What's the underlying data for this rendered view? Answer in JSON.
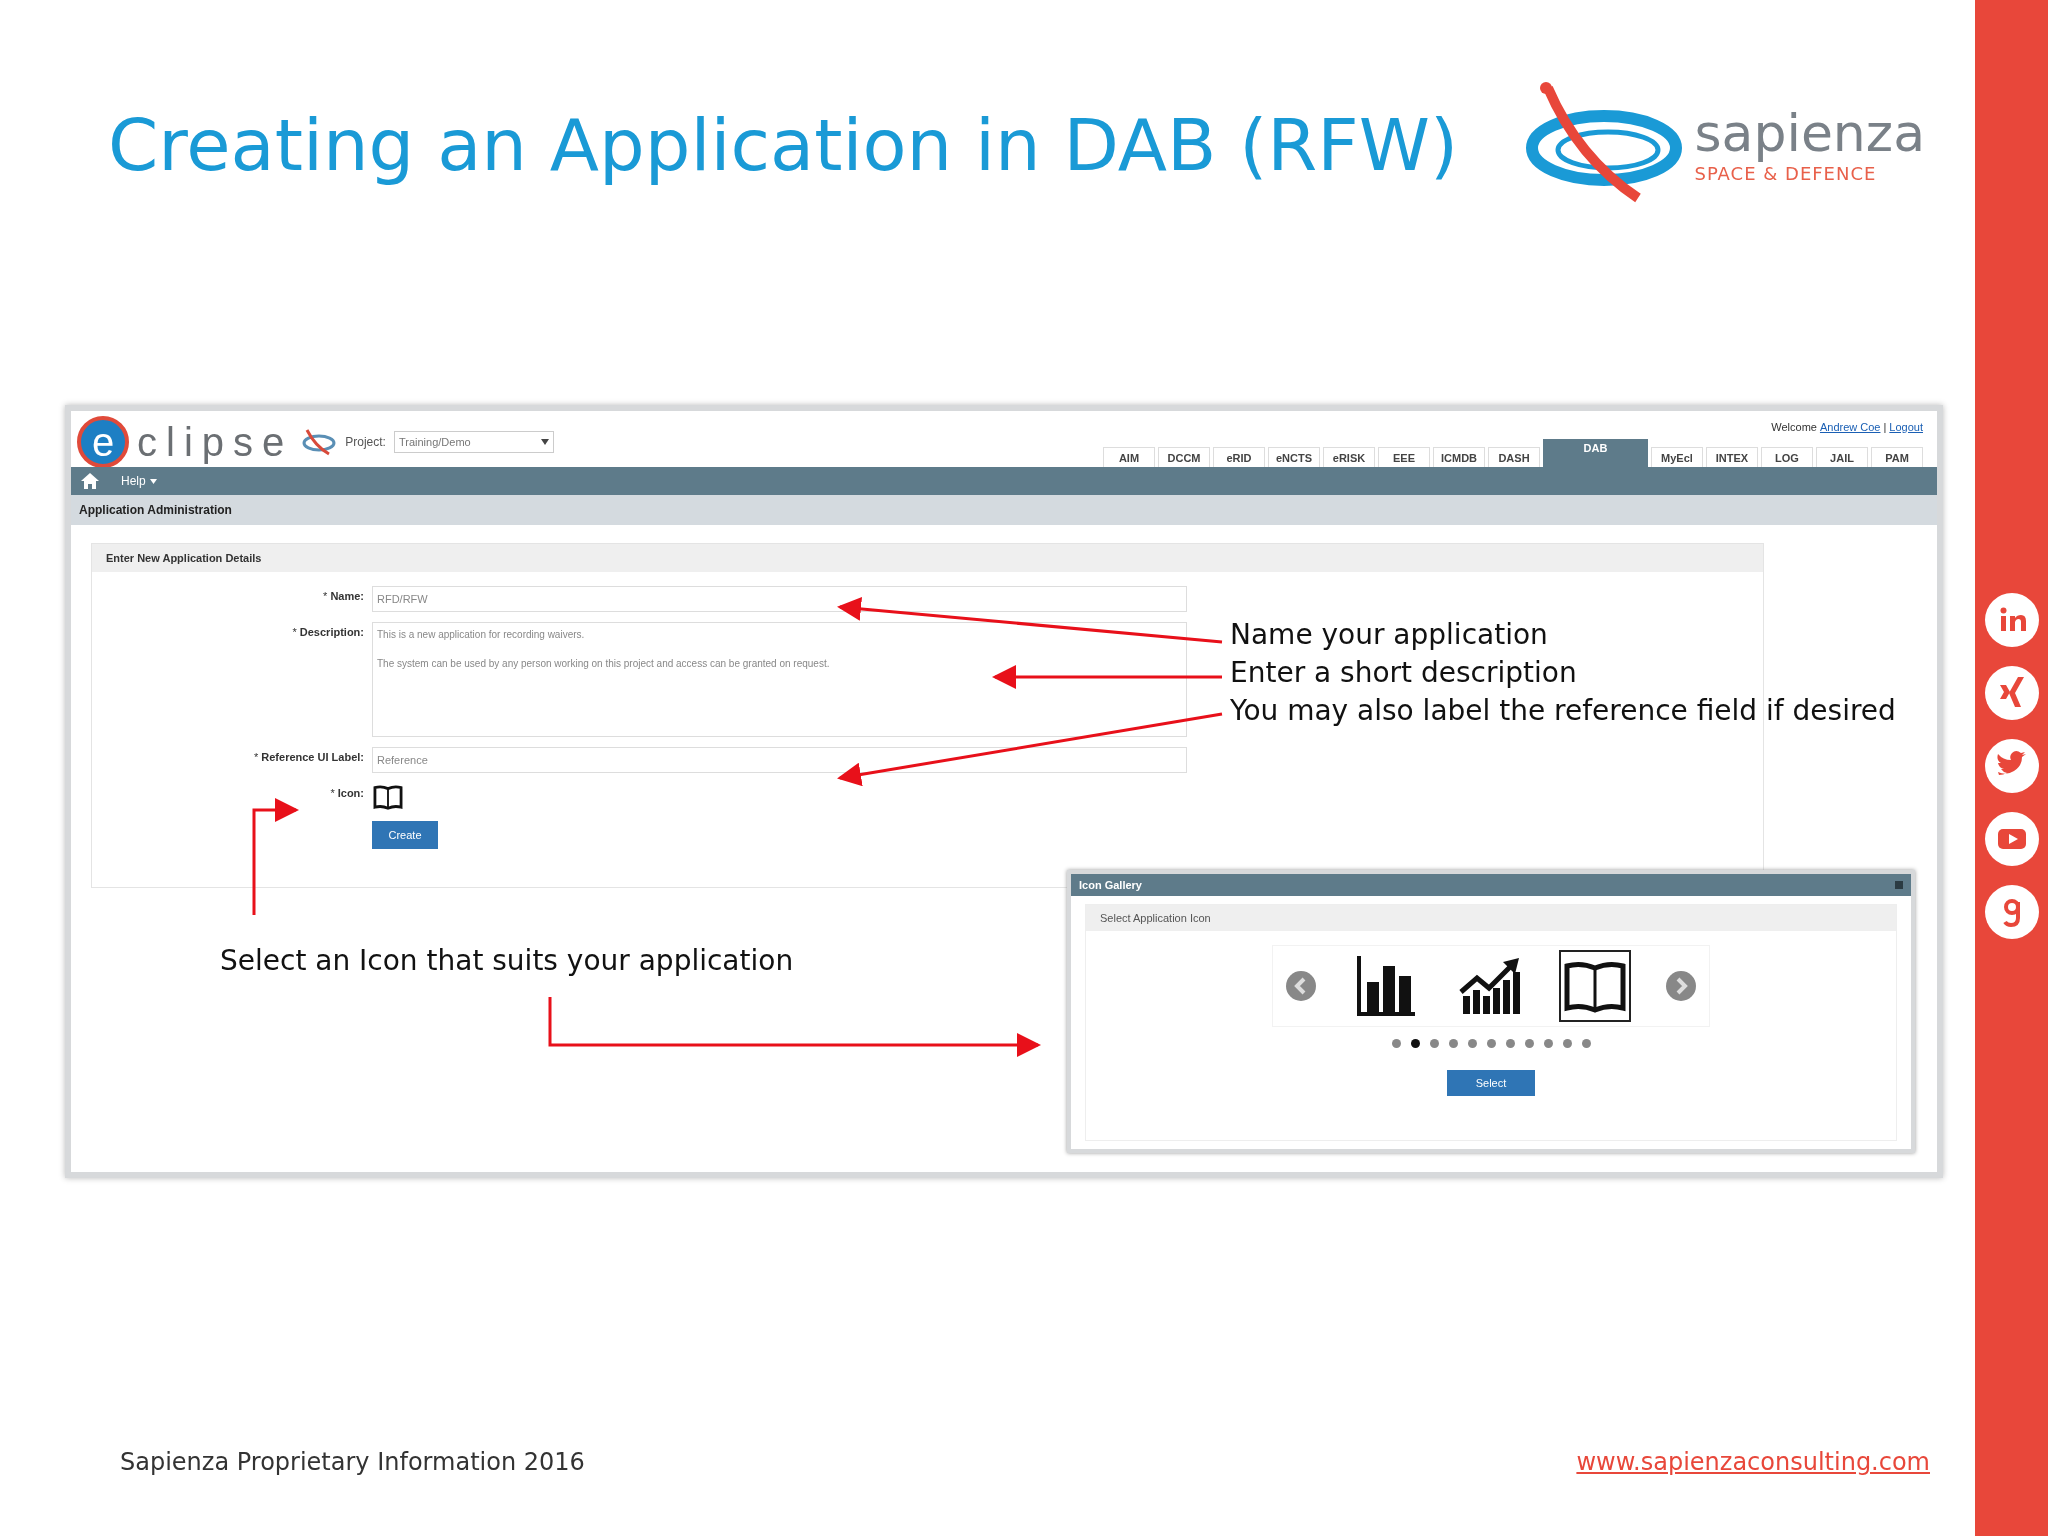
{
  "slide": {
    "title": "Creating an Application in DAB (RFW)",
    "logo": {
      "name": "sapienza",
      "tagline": "SPACE & DEFENCE"
    }
  },
  "app": {
    "logo": {
      "badge": "e",
      "text": "clipse"
    },
    "project": {
      "label": "Project:",
      "value": "Training/Demo"
    },
    "welcome": {
      "text": "Welcome",
      "user": "Andrew Coe",
      "separator": "|",
      "logout": "Logout"
    },
    "tabs": [
      {
        "label": "AIM",
        "selected": false
      },
      {
        "label": "DCCM",
        "selected": false
      },
      {
        "label": "eRID",
        "selected": false
      },
      {
        "label": "eNCTS",
        "selected": false
      },
      {
        "label": "eRISK",
        "selected": false
      },
      {
        "label": "EEE",
        "selected": false
      },
      {
        "label": "ICMDB",
        "selected": false
      },
      {
        "label": "DASH",
        "selected": false
      },
      {
        "label": "DAB",
        "selected": true
      },
      {
        "label": "MyEcl",
        "selected": false
      },
      {
        "label": "INTEX",
        "selected": false
      },
      {
        "label": "LOG",
        "selected": false
      },
      {
        "label": "JAIL",
        "selected": false
      },
      {
        "label": "PAM",
        "selected": false
      }
    ],
    "menu": [
      {
        "label": "Help"
      }
    ],
    "page_title": "Application Administration",
    "form": {
      "title": "Enter New Application Details",
      "fields": [
        {
          "kind": "input",
          "required_mark": "*",
          "label": "Name:",
          "value": "RFD/RFW"
        },
        {
          "kind": "textarea",
          "required_mark": "*",
          "label": "Description:",
          "lines": [
            "This is a new application for recording waivers.",
            "The system can be used by any person working on this project and access can be granted on request."
          ]
        },
        {
          "kind": "input",
          "required_mark": "*",
          "label": "Reference UI Label:",
          "value": "Reference"
        },
        {
          "kind": "icon",
          "required_mark": "*",
          "label": "Icon:"
        }
      ],
      "button": "Create"
    },
    "gallery": {
      "title": "Icon Gallery",
      "section": "Select Application Icon",
      "icons": [
        {
          "kind": "bar-chart",
          "selected": false
        },
        {
          "kind": "growth-chart",
          "selected": false
        },
        {
          "kind": "book",
          "selected": true
        }
      ],
      "pages": [
        {
          "selected": false
        },
        {
          "selected": true
        },
        {
          "selected": false
        },
        {
          "selected": false
        },
        {
          "selected": false
        },
        {
          "selected": false
        },
        {
          "selected": false
        },
        {
          "selected": false
        },
        {
          "selected": false
        },
        {
          "selected": false
        },
        {
          "selected": false
        }
      ],
      "button": "Select"
    }
  },
  "annotations": [
    {
      "text": "Name your application"
    },
    {
      "text": "Enter a short description"
    },
    {
      "text": "You may also label the reference field if desired"
    },
    {
      "text": "Select an Icon that suits your application"
    }
  ],
  "footer": {
    "text": "Sapienza Proprietary Information 2016",
    "link": "www.sapienzaconsulting.com"
  },
  "social": [
    {
      "kind": "linkedin"
    },
    {
      "kind": "xing"
    },
    {
      "kind": "twitter"
    },
    {
      "kind": "youtube"
    },
    {
      "kind": "google"
    }
  ]
}
